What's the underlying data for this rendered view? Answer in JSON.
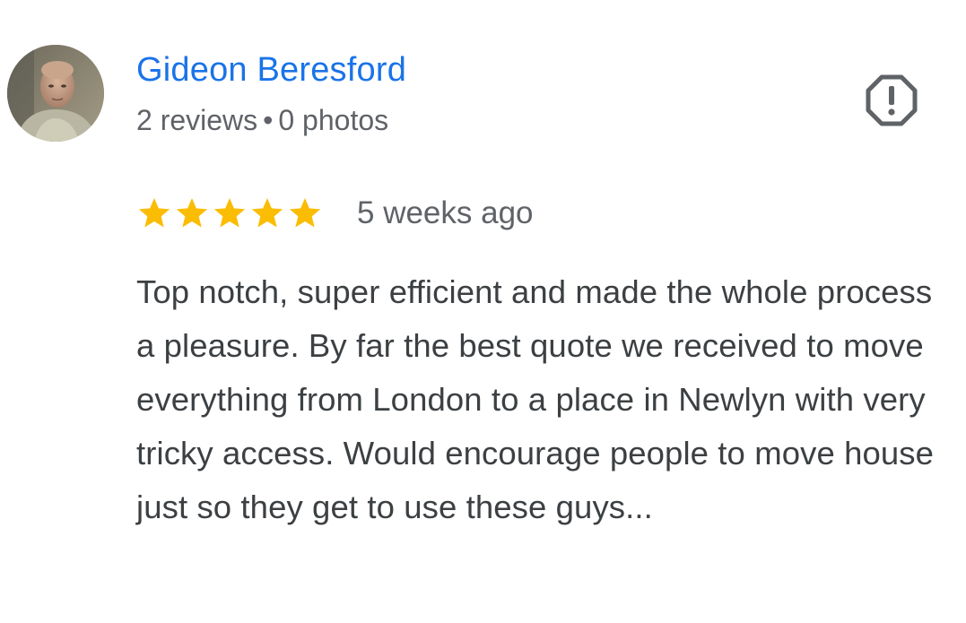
{
  "review": {
    "reviewer_name": "Gideon Beresford",
    "reviews_count": "2 reviews",
    "separator": "•",
    "photos_count": "0 photos",
    "rating": 5,
    "rating_max": 5,
    "time_ago": "5 weeks ago",
    "text": "Top notch, super efficient and made the whole process a pleasure. By far the best quote we received to move everything from London to a place in Newlyn with very tricky access. Would encourage people to move house just so they get to use these guys..."
  },
  "icons": {
    "avatar": "avatar-photo",
    "report": "report-flag-icon",
    "star": "star-icon"
  },
  "colors": {
    "name": "#1a73e8",
    "meta": "#5f6368",
    "text": "#3c4043",
    "star": "#fbbc04",
    "report_icon": "#5f6368"
  }
}
